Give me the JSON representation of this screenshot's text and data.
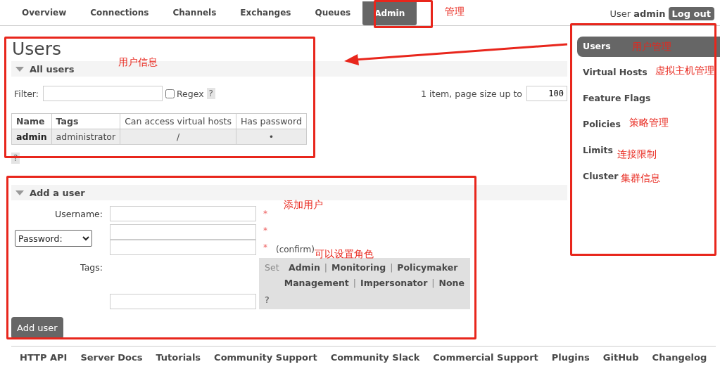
{
  "nav": {
    "tabs": [
      {
        "label": "Overview",
        "selected": false
      },
      {
        "label": "Connections",
        "selected": false
      },
      {
        "label": "Channels",
        "selected": false
      },
      {
        "label": "Exchanges",
        "selected": false
      },
      {
        "label": "Queues",
        "selected": false
      },
      {
        "label": "Admin",
        "selected": true
      }
    ],
    "user_label": "User",
    "user_name": "admin",
    "logout": "Log out"
  },
  "page_title": "Users",
  "all_users": {
    "heading": "All users",
    "expanded": true,
    "filter_label": "Filter:",
    "regex_label": "Regex",
    "regex_checked": false,
    "help": "?",
    "paging_text": "1 item, page size up to",
    "page_size": "100",
    "columns": [
      "Name",
      "Tags",
      "Can access virtual hosts",
      "Has password"
    ],
    "rows": [
      {
        "name": "admin",
        "tags": "administrator",
        "vhosts": "/",
        "has_password": "•"
      }
    ],
    "table_help": "?"
  },
  "add_user": {
    "heading": "Add a user",
    "expanded": true,
    "username_label": "Username:",
    "username_required": "*",
    "password_select": "Password:",
    "password_required": "*",
    "confirm_required": "*",
    "confirm_note": "(confirm)",
    "tags_label": "Tags:",
    "set_label": "Set",
    "tag_rows": [
      [
        {
          "label": "Admin",
          "separator": "|"
        },
        {
          "label": "Monitoring",
          "separator": "|"
        },
        {
          "label": "Policymaker"
        }
      ],
      [
        {
          "label": "Management",
          "separator": "|"
        },
        {
          "label": "Impersonator",
          "separator": "|"
        },
        {
          "label": "None"
        }
      ]
    ],
    "tags_help": "?",
    "button": "Add user"
  },
  "sidebar": {
    "items": [
      {
        "label": "Users",
        "selected": true
      },
      {
        "label": "Virtual Hosts",
        "selected": false
      },
      {
        "label": "Feature Flags",
        "selected": false
      },
      {
        "label": "Policies",
        "selected": false
      },
      {
        "label": "Limits",
        "selected": false
      },
      {
        "label": "Cluster",
        "selected": false
      }
    ]
  },
  "footer": {
    "links": [
      "HTTP API",
      "Server Docs",
      "Tutorials",
      "Community Support",
      "Community Slack",
      "Commercial Support",
      "Plugins",
      "GitHub",
      "Changelog"
    ]
  },
  "annotations": [
    {
      "text": "管理"
    },
    {
      "text": "用户信息"
    },
    {
      "text": "用户管理"
    },
    {
      "text": "虚拟主机管理"
    },
    {
      "text": "策略管理"
    },
    {
      "text": "连接限制"
    },
    {
      "text": "集群信息"
    },
    {
      "text": "添加用户"
    },
    {
      "text": "可以设置角色"
    }
  ]
}
